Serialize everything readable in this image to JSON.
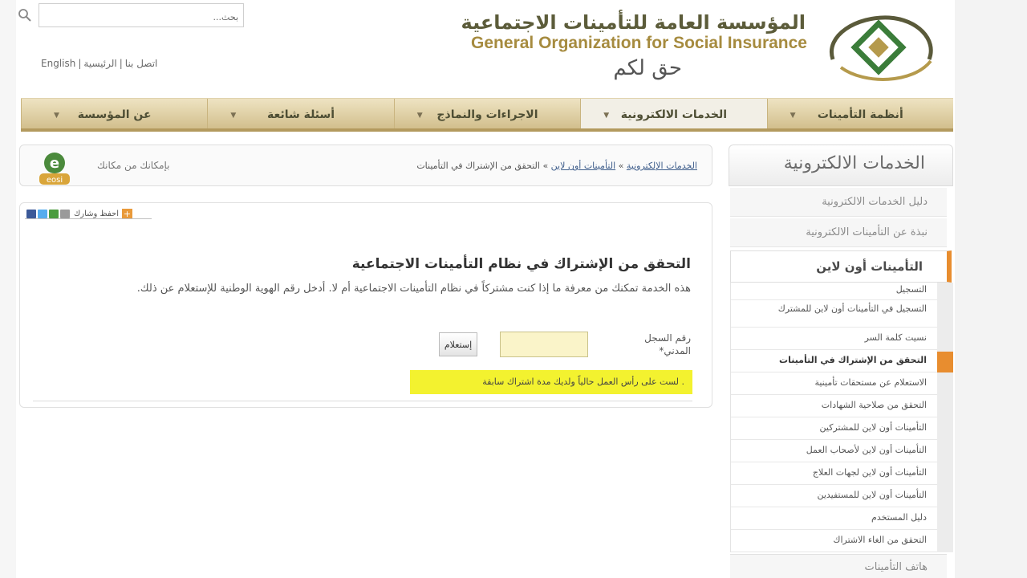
{
  "header": {
    "search_placeholder": "بحث...",
    "links": [
      "الرئيسية",
      "اتصل بنا",
      "English"
    ],
    "logo_ar": "المؤسسة العامة للتأمينات الاجتماعية",
    "logo_en": "General Organization for Social Insurance",
    "slogan": "حق لكم"
  },
  "nav": [
    {
      "label": "أنظمة التأمينات"
    },
    {
      "label": "الخدمات الالكترونية"
    },
    {
      "label": "الاجراءات والنماذج"
    },
    {
      "label": "أسئلة شائعة"
    },
    {
      "label": "عن المؤسسة"
    }
  ],
  "breadcrumb": {
    "item1": "الخدمات الإلكترونية",
    "sep": "»",
    "item2": "التأمينات أون لاين",
    "item3": "التحقق من الإشتراك في التأمينات",
    "eos_text": "بإمكانك من مكانك",
    "eos_letters": "e",
    "eos_sub": "eosi"
  },
  "content": {
    "share_label": "احفظ وشارك",
    "title": "التحقق من الإشتراك في نظام التأمينات الاجتماعية",
    "description": "هذه الخدمة تمكنك من معرفة ما إذا كنت مشتركاً في نظام التأمينات الاجتماعية أم لا. أدخل رقم الهوية الوطنية للإستعلام عن ذلك.",
    "field_label": "رقم السجل المدني*",
    "id_value": "",
    "query_button": "إستعلام",
    "result": ". لست على رأس العمل حالياً ولديك مدة اشتراك سابقة"
  },
  "sidebar": {
    "title": "الخدمات الالكترونية",
    "items": [
      "دليل الخدمات الالكترونية",
      "نبذة عن التأمينات الالكترونية"
    ],
    "section": "التأمينات أون لاين",
    "subitems": [
      "التسجيل",
      "التسجيل في التأمينات أون لاين للمشترك",
      "نسيت كلمة السر",
      "التحقق من الإشتراك في التأمينات",
      "الاستعلام عن مستحقات تأمينية",
      "التحقق من صلاحية الشهادات",
      "التأمينات أون لاين للمشتركين",
      "التأمينات أون لاين لأصحاب العمل",
      "التأمينات أون لاين لجهات العلاج",
      "التأمينات أون لاين للمستفيدين",
      "دليل المستخدم",
      "التحقق من الغاء الاشتراك"
    ],
    "last_item": "هاتف التأمينات"
  },
  "colors": {
    "accent_orange": "#e88d2f",
    "nav_gold": "#d2bf8d",
    "highlight_yellow": "#f3f22f",
    "logo_gold": "#a68b3f"
  }
}
